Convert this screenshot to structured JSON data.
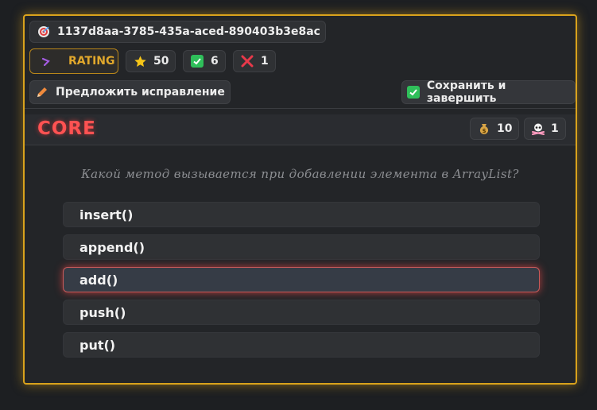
{
  "header": {
    "id": "1137d8aa-3785-435a-aced-890403b3e8ac"
  },
  "stats": {
    "rating_label": "RATING",
    "stars": "50",
    "correct": "6",
    "wrong": "1"
  },
  "actions": {
    "suggest_label": "Предложить исправление",
    "save_label": "Сохранить и завершить"
  },
  "topic": {
    "label": "CORE",
    "coins": "10",
    "skulls": "1"
  },
  "question": {
    "text": "Какой метод вызывается при добавлении элемента в ArrayList?"
  },
  "answers": [
    {
      "label": "insert()",
      "selected": false
    },
    {
      "label": "append()",
      "selected": false
    },
    {
      "label": "add()",
      "selected": true
    },
    {
      "label": "push()",
      "selected": false
    },
    {
      "label": "put()",
      "selected": false
    }
  ],
  "colors": {
    "accent_border": "#d9a21c",
    "core_text": "#ff5252",
    "selected_glow": "#e64646"
  }
}
